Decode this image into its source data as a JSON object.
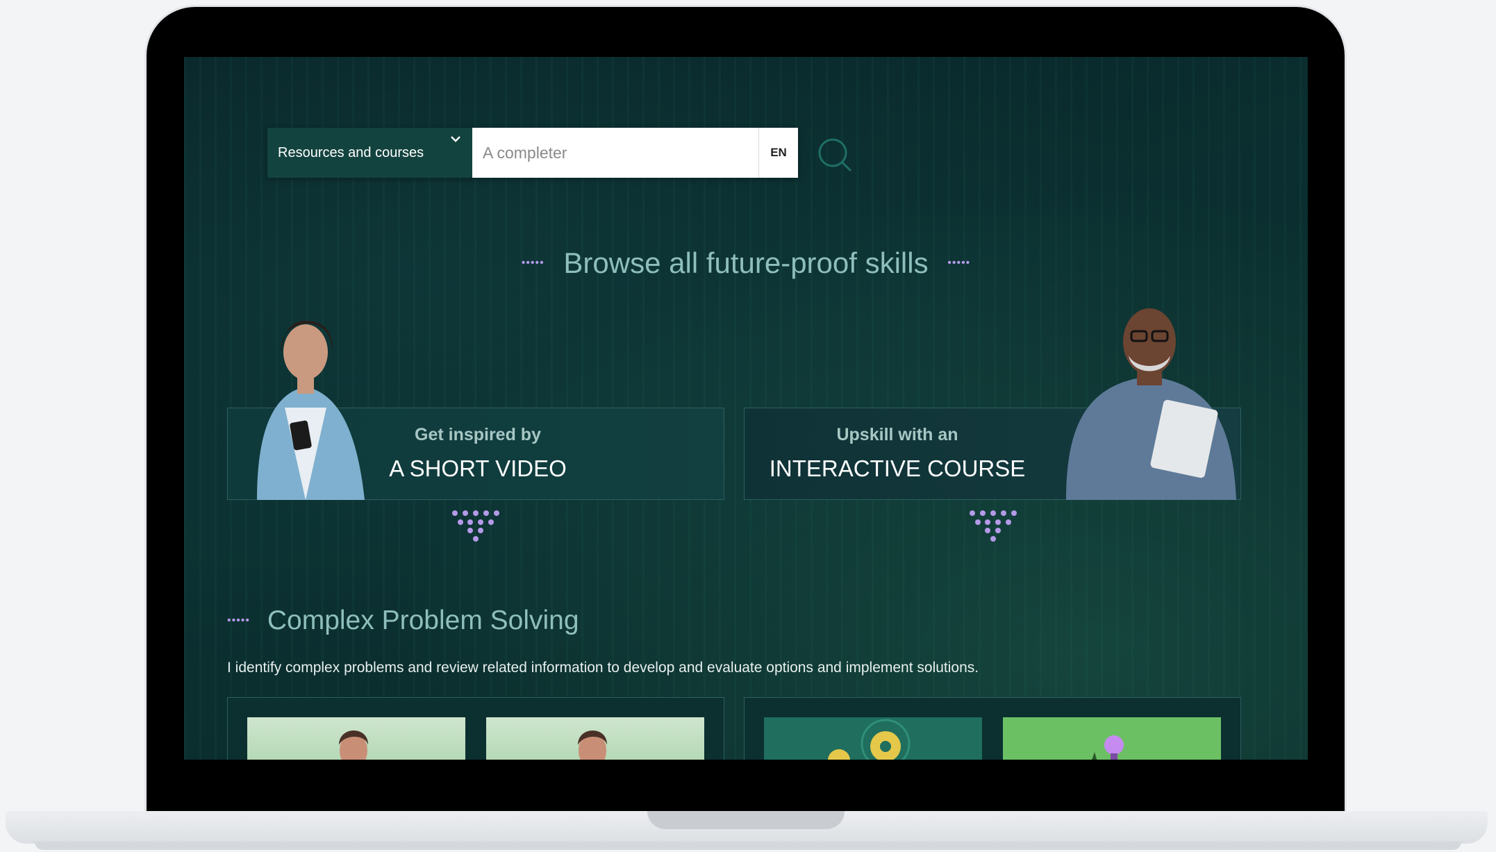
{
  "search": {
    "category_label": "Resources and courses",
    "placeholder": "A completer",
    "language": "EN"
  },
  "browse_heading": "Browse all future-proof skills",
  "cards": [
    {
      "pre": "Get inspired by",
      "main": "A SHORT VIDEO"
    },
    {
      "pre": "Upskill with an",
      "main": "INTERACTIVE COURSE"
    }
  ],
  "section": {
    "title": "Complex Problem Solving",
    "description": "I identify complex problems and review related information to develop and evaluate options and implement solutions."
  },
  "colors": {
    "background": "#0a2a2a",
    "accent_dots": "#b49ae8",
    "heading": "#8fbfbc",
    "select_bg": "#13433f"
  },
  "icons": [
    "chevron-down-icon",
    "search-icon"
  ]
}
